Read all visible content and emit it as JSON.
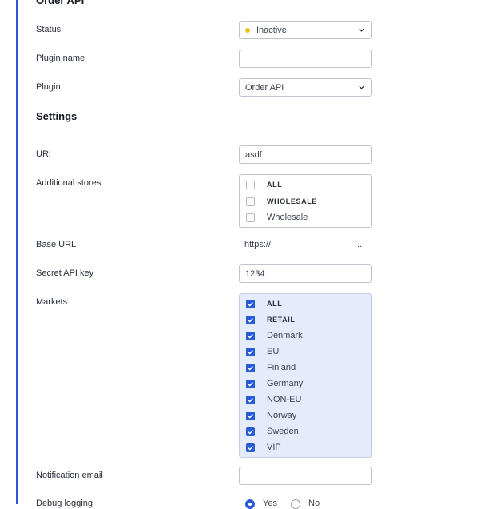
{
  "section_order_api": "Order API",
  "section_settings": "Settings",
  "fields": {
    "status": {
      "label": "Status",
      "value": "Inactive",
      "indicator_color": "#f2c014"
    },
    "plugin_name": {
      "label": "Plugin name",
      "value": ""
    },
    "plugin": {
      "label": "Plugin",
      "value": "Order API"
    },
    "uri": {
      "label": "URI",
      "value": "asdf"
    },
    "additional_stores": {
      "label": "Additional stores",
      "options": [
        {
          "label": "ALL",
          "checked": false
        },
        {
          "label": "WHOLESALE",
          "checked": false
        },
        {
          "label": "Wholesale",
          "checked": false
        }
      ]
    },
    "base_url": {
      "label": "Base URL",
      "value": "https://",
      "ellipsis": "..."
    },
    "secret_api_key": {
      "label": "Secret API key",
      "value": "1234"
    },
    "markets": {
      "label": "Markets",
      "options": [
        {
          "label": "ALL",
          "checked": true
        },
        {
          "label": "RETAIL",
          "checked": true
        },
        {
          "label": "Denmark",
          "checked": true
        },
        {
          "label": "EU",
          "checked": true
        },
        {
          "label": "Finland",
          "checked": true
        },
        {
          "label": "Germany",
          "checked": true
        },
        {
          "label": "NON-EU",
          "checked": true
        },
        {
          "label": "Norway",
          "checked": true
        },
        {
          "label": "Sweden",
          "checked": true
        },
        {
          "label": "VIP",
          "checked": true
        }
      ]
    },
    "notification_email": {
      "label": "Notification email",
      "value": ""
    },
    "debug_logging": {
      "label": "Debug logging",
      "options": [
        {
          "label": "Yes",
          "selected": true
        },
        {
          "label": "No",
          "selected": false
        }
      ]
    }
  },
  "colors": {
    "accent": "#2a5bd7",
    "selected_list_bg": "#e5ebfb"
  }
}
